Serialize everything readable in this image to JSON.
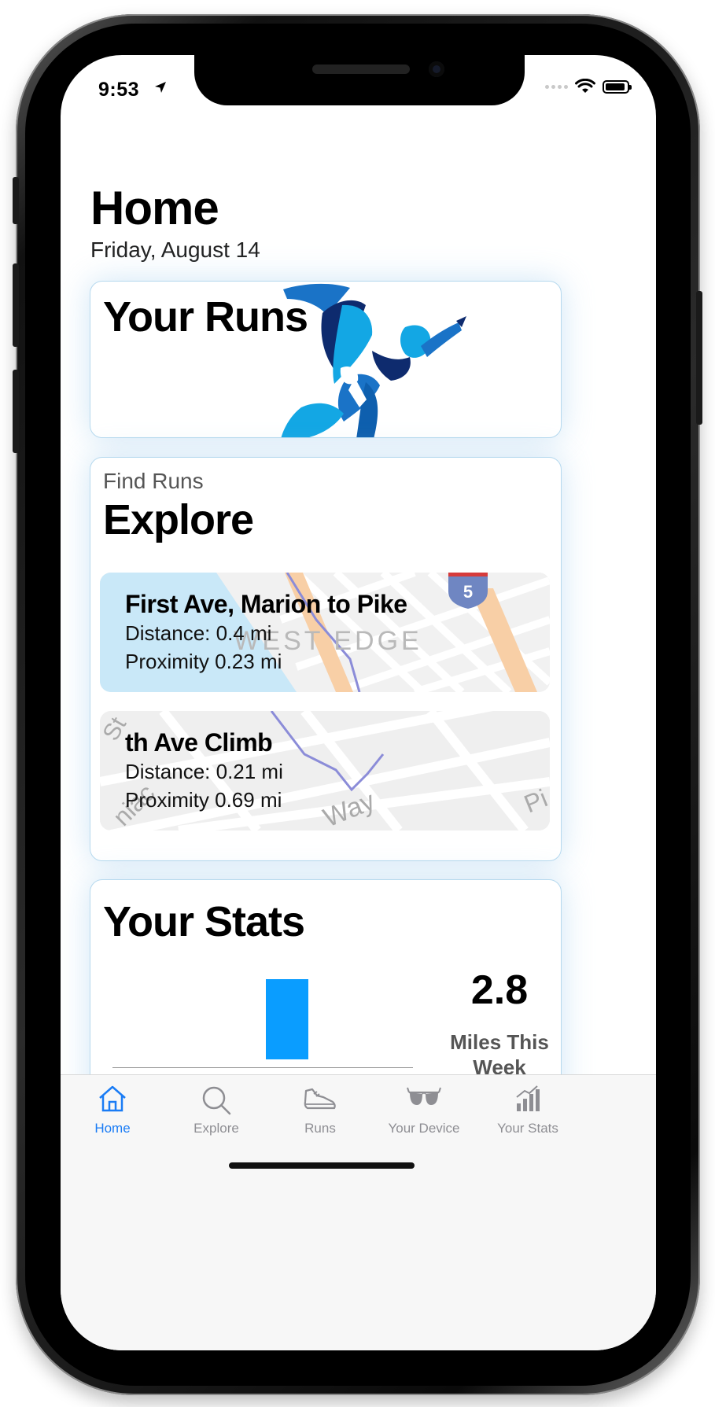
{
  "status_bar": {
    "time": "9:53"
  },
  "header": {
    "title": "Home",
    "date": "Friday, August 14"
  },
  "cards": {
    "runs": {
      "title": "Your Runs"
    },
    "explore": {
      "subtitle": "Find Runs",
      "title": "Explore",
      "routes": [
        {
          "name": "First Ave, Marion to Pike",
          "distance": "Distance: 0.4 mi",
          "proximity": "Proximity 0.23 mi"
        },
        {
          "name": "th Ave Climb",
          "distance": "Distance: 0.21 mi",
          "proximity": "Proximity 0.69 mi"
        }
      ],
      "map_labels": {
        "neighborhood": "WEST EDGE",
        "highway": "5",
        "street_a": "St",
        "street_b": "Way",
        "street_c": "Pi",
        "street_d": "niac"
      }
    },
    "stats": {
      "title": "Your Stats",
      "value": "2.8",
      "value_label": "Miles This Week",
      "chart_data": {
        "type": "bar",
        "categories": [
          ""
        ],
        "values": [
          2.8
        ],
        "title": "",
        "xlabel": "",
        "ylabel": ""
      }
    }
  },
  "tab_bar": {
    "active": "Home",
    "tabs": [
      {
        "label": "Home",
        "icon": "home-icon"
      },
      {
        "label": "Explore",
        "icon": "search-icon"
      },
      {
        "label": "Runs",
        "icon": "shoe-icon"
      },
      {
        "label": "Your Device",
        "icon": "glasses-icon"
      },
      {
        "label": "Your Stats",
        "icon": "stats-icon"
      }
    ]
  },
  "colors": {
    "accent": "#1a7cf5",
    "bar": "#0a9dff",
    "card_border": "#b6d9ee"
  }
}
